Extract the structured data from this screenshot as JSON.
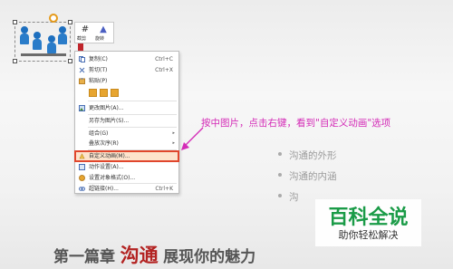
{
  "mini_toolbar": {
    "crop_label": "截剪",
    "rotate_label": "旋转"
  },
  "context_menu": {
    "items": [
      {
        "label": "复制(C)",
        "shortcut": "Ctrl+C"
      },
      {
        "label": "剪切(T)",
        "shortcut": "Ctrl+X"
      },
      {
        "label": "粘贴(P)",
        "shortcut": ""
      },
      {
        "label": "更改图片(A)...",
        "shortcut": ""
      },
      {
        "label": "另存为图片(S)...",
        "shortcut": ""
      },
      {
        "label": "组合(G)",
        "shortcut": ""
      },
      {
        "label": "叠放次序(R)",
        "shortcut": ""
      },
      {
        "label": "自定义动画(M)...",
        "shortcut": ""
      },
      {
        "label": "动作设置(A)...",
        "shortcut": ""
      },
      {
        "label": "设置对象格式(O)...",
        "shortcut": ""
      },
      {
        "label": "超链接(H)...",
        "shortcut": "Ctrl+K"
      }
    ]
  },
  "annotation": "按中图片，点击右键，看到\"自定义动画\"选项",
  "bullets": [
    "沟通的外形",
    "沟通的内涵",
    "沟"
  ],
  "watermark": {
    "title": "百科全说",
    "subtitle": "助你轻松解决"
  },
  "heading": {
    "part1": "第一篇章",
    "part2": "沟通",
    "part3": "展现你的魅力"
  },
  "colors": {
    "highlight_border": "#e0462c",
    "annotation": "#d42bb7",
    "heading_accent": "#b32322",
    "watermark_green": "#1a9b47"
  }
}
